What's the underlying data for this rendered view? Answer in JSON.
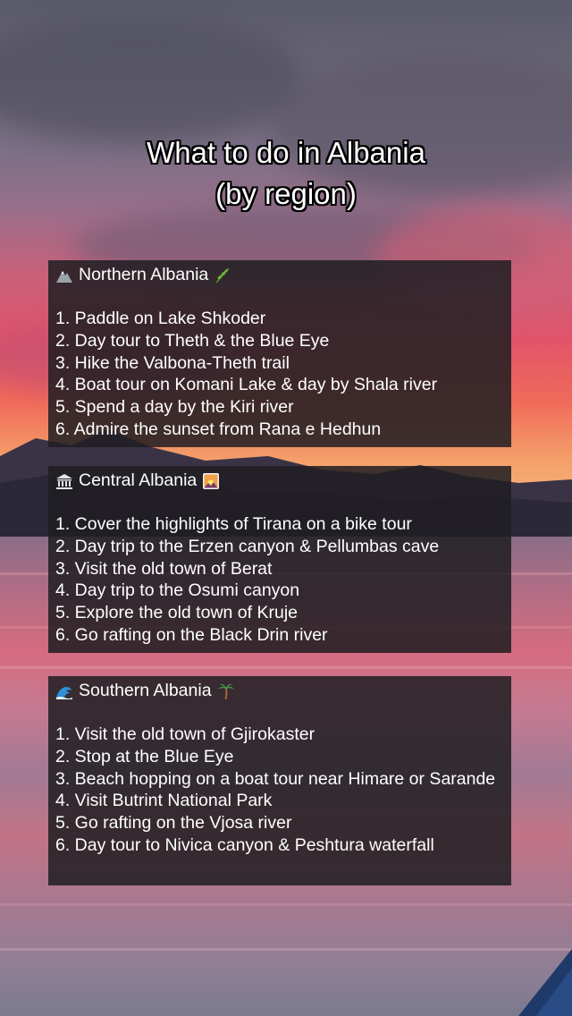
{
  "title_line1": "What to do in Albania",
  "title_line2": "(by region)",
  "sections": [
    {
      "heading": "Northern Albania",
      "icon_left": "mountain-icon",
      "icon_right": "herb-icon",
      "items": [
        "1. Paddle on Lake Shkoder",
        "2. Day tour to Theth & the Blue Eye",
        "3. Hike the Valbona-Theth trail",
        "4. Boat tour on Komani Lake & day by Shala river",
        "5. Spend a day by the Kiri river",
        "6. Admire the sunset from Rana e Hedhun"
      ]
    },
    {
      "heading": "Central Albania",
      "icon_left": "classical-building-icon",
      "icon_right": "sunrise-icon",
      "items": [
        "1. Cover the highlights of Tirana on a bike tour",
        "2. Day trip to the Erzen canyon & Pellumbas cave",
        "3. Visit the old town of Berat",
        "4. Day trip to the Osumi canyon",
        "5. Explore the old town of Kruje",
        "6. Go rafting on the Black Drin river"
      ]
    },
    {
      "heading": "Southern Albania",
      "icon_left": "wave-icon",
      "icon_right": "palm-tree-icon",
      "items": [
        "1. Visit the old town of Gjirokaster",
        "2. Stop at the Blue Eye",
        "3. Beach hopping on a boat tour near Himare or Sarande",
        "4. Visit Butrint National Park",
        "5. Go rafting on the Vjosa river",
        "6. Day tour to Nivica canyon & Peshtura waterfall"
      ]
    }
  ]
}
